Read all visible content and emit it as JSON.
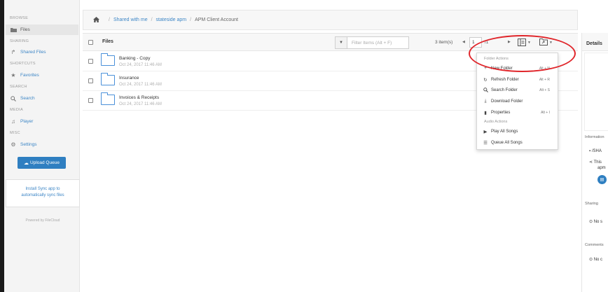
{
  "sidebar": {
    "sections": [
      {
        "title": "BROWSE",
        "items": [
          {
            "label": "Files",
            "icon": "folder-icon"
          }
        ]
      },
      {
        "title": "SHARING",
        "items": [
          {
            "label": "Shared Files",
            "icon": "share-icon"
          }
        ]
      },
      {
        "title": "SHORTCUTS",
        "items": [
          {
            "label": "Favorites",
            "icon": "star-icon"
          }
        ]
      },
      {
        "title": "SEARCH",
        "items": [
          {
            "label": "Search",
            "icon": "search-icon"
          }
        ]
      },
      {
        "title": "MEDIA",
        "items": [
          {
            "label": "Player",
            "icon": "music-icon"
          }
        ]
      },
      {
        "title": "MISC",
        "items": [
          {
            "label": "Settings",
            "icon": "gear-icon"
          }
        ]
      }
    ],
    "upload_label": "Upload Queue",
    "sync_line1": "Install Sync app to",
    "sync_line2": "automatically sync files",
    "powered_by": "Powered by FileCloud"
  },
  "breadcrumb": {
    "items": [
      "Shared with me",
      "stateside apm",
      "APM Client Account"
    ]
  },
  "files_header": {
    "title": "Files",
    "filter_placeholder": "Filter Items (Alt + F)",
    "item_count": "3 item(s)",
    "page": "1",
    "page_total": "/1"
  },
  "files": [
    {
      "name": "Banking - Copy",
      "date": "Oct 24, 2017 11:46 AM"
    },
    {
      "name": "Insurance",
      "date": "Oct 24, 2017 11:46 AM"
    },
    {
      "name": "Invoices & Receipts",
      "date": "Oct 24, 2017 11:46 AM"
    }
  ],
  "menu": {
    "folder_header": "Folder Actions",
    "audio_header": "Audio Actions",
    "items": [
      {
        "label": "New Folder",
        "shortcut": "Alt + N",
        "icon": "plus-icon"
      },
      {
        "label": "Refresh Folder",
        "shortcut": "Alt + R",
        "icon": "refresh-icon"
      },
      {
        "label": "Search Folder",
        "shortcut": "Alt + S",
        "icon": "search-icon"
      },
      {
        "label": "Download Folder",
        "shortcut": "",
        "icon": "download-icon"
      },
      {
        "label": "Properties",
        "shortcut": "Alt + I",
        "icon": "book-icon"
      },
      {
        "label": "Play All Songs",
        "shortcut": "",
        "icon": "play-icon"
      },
      {
        "label": "Queue All Songs",
        "shortcut": "",
        "icon": "list-icon"
      }
    ]
  },
  "right_panel": {
    "tab": "Details",
    "information_label": "Information",
    "path_text": "/SHA",
    "share_text_1": "This",
    "share_text_2": "apm",
    "sharing_label": "Sharing",
    "sharing_value": "No s",
    "comments_label": "Comments",
    "comments_value": "No c"
  },
  "colors": {
    "accent": "#2f7fc1",
    "link": "#3d86c6",
    "annotation": "#e0262b"
  }
}
